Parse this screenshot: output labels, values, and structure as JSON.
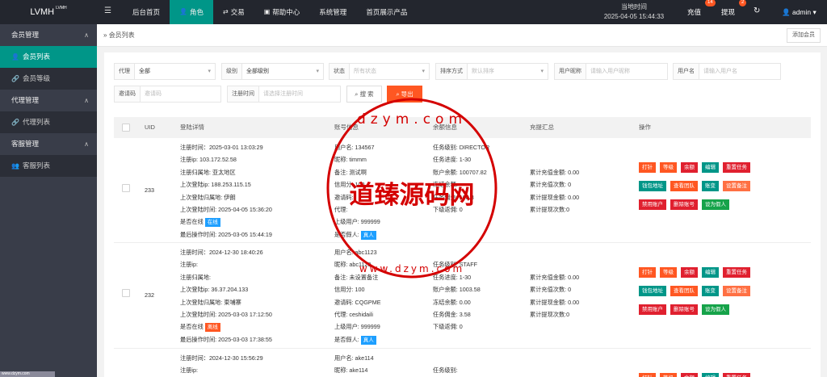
{
  "app": {
    "logo": "LVMH",
    "logo_sup": "LVMH"
  },
  "topnav": [
    {
      "label": "后台首页",
      "icon": "",
      "active": false
    },
    {
      "label": "角色",
      "icon": "user-icon",
      "active": true
    },
    {
      "label": "交易",
      "icon": "exchange-icon",
      "active": false
    },
    {
      "label": "帮助中心",
      "icon": "message-icon",
      "active": false
    },
    {
      "label": "系统管理",
      "icon": "",
      "active": false
    },
    {
      "label": "首页展示产品",
      "icon": "",
      "active": false
    }
  ],
  "header": {
    "time_label": "当地时间",
    "time_value": "2025-04-05 15:44:33",
    "recharge": "充值",
    "recharge_count": "14",
    "withdraw": "提现",
    "withdraw_count": "2",
    "user": "admin"
  },
  "sidebar": [
    {
      "label": "会员管理",
      "type": "group"
    },
    {
      "label": "会员列表",
      "type": "sub",
      "active": true,
      "icon": "user-icon"
    },
    {
      "label": "会员等级",
      "type": "sub",
      "active": false,
      "icon": "link-icon"
    },
    {
      "label": "代理管理",
      "type": "group"
    },
    {
      "label": "代理列表",
      "type": "sub",
      "active": false,
      "icon": "link-icon"
    },
    {
      "label": "客服管理",
      "type": "group"
    },
    {
      "label": "客服列表",
      "type": "sub",
      "active": false,
      "icon": "users-icon"
    }
  ],
  "breadcrumb": {
    "sep": "»",
    "current": "会员列表"
  },
  "add_member": "添加会员",
  "filters": {
    "agent": {
      "label": "代理",
      "value": "全部"
    },
    "level": {
      "label": "级别",
      "value": "全部级别"
    },
    "status": {
      "label": "状态",
      "value": "所有状态"
    },
    "sort": {
      "label": "排序方式",
      "value": "默认排序"
    },
    "nickname": {
      "label": "用户昵称",
      "placeholder": "请输入用户昵称"
    },
    "username": {
      "label": "用户名",
      "placeholder": "请输入用户名"
    },
    "invite": {
      "label": "邀请码",
      "placeholder": "邀请码"
    },
    "regtime": {
      "label": "注册时间",
      "placeholder": "请选择注册时间"
    },
    "search": "搜 索",
    "export": "导出"
  },
  "table": {
    "headers": {
      "uid": "UID",
      "login": "登陆详情",
      "account": "账号信息",
      "balance": "余额信息",
      "summary": "充提汇总",
      "ops": "操作"
    },
    "rows": [
      {
        "uid": "233",
        "login": [
          "注册时间：2025-03-01 13:03:29",
          "注册ip: 103.172.52.58",
          "注册归属地: 亚太地区",
          "上次登陆ip: 188.253.115.15",
          "上次登陆归属地: 伊朗",
          "上次登陆时间: 2025-04-05 15:36:20",
          "是否在线",
          "最后操作时间: 2025-03-05 15:44:19"
        ],
        "online": "在线",
        "account": [
          "用户名: 134567",
          "昵称: timmm",
          "备注: 测试啊",
          "信用分: 100",
          "邀请码:",
          "代理:",
          "上级用户: 999999",
          "是否假人:"
        ],
        "fake": "真人",
        "balance": [
          "",
          "任务级别: DIRECTOR",
          "任务进度: 1-30",
          "账户余额: 100707.82",
          "冻结余额:",
          "任务佣金: 108.8",
          "下级返佣: 0"
        ],
        "summary": [
          "",
          "",
          "累计充值金额: 0.00",
          "累计充值次数: 0",
          "累计提现金额: 0.00",
          "累计提现次数:0"
        ]
      },
      {
        "uid": "232",
        "login": [
          "注册时间：2024-12-30 18:40:26",
          "注册ip:",
          "注册归属地:",
          "上次登陆ip: 36.37.204.133",
          "上次登陆归属地: 柬埔寨",
          "上次登陆时间: 2025-03-03 17:12:50",
          "是否在线",
          "最后操作时间: 2025-03-03 17:38:55"
        ],
        "online": "离线",
        "account": [
          "用户名: abc1123",
          "昵称: abc1123",
          "备注: 未设置备注",
          "信用分: 100",
          "邀请码: CQGPME",
          "代理: ceshidaili",
          "上级用户: 999999",
          "是否假人:"
        ],
        "fake": "真人",
        "balance": [
          "",
          "任务级别: STAFF",
          "任务进度: 1-30",
          "账户余额: 1003.58",
          "冻结余额: 0.00",
          "任务佣金: 3.58",
          "下级返佣: 0"
        ],
        "summary": [
          "",
          "",
          "累计充值金额: 0.00",
          "累计充值次数: 0",
          "累计提现金额: 0.00",
          "累计提现次数:0"
        ]
      },
      {
        "uid": "",
        "login": [
          "注册时间：2024-12-30 15:56:29",
          "注册ip:"
        ],
        "account": [
          "用户名: ake114",
          "昵称: ake114"
        ],
        "balance": [
          "",
          "任务级别:"
        ]
      }
    ],
    "ops": [
      [
        {
          "label": "打针",
          "c": "o"
        },
        {
          "label": "等级",
          "c": "o"
        },
        {
          "label": "余额",
          "c": "r"
        },
        {
          "label": "编辑",
          "c": "g"
        },
        {
          "label": "重置任务",
          "c": "r"
        }
      ],
      [
        {
          "label": "钱包地址",
          "c": "g"
        },
        {
          "label": "查看团队",
          "c": "o"
        },
        {
          "label": "账变",
          "c": "g"
        },
        {
          "label": "设置备注",
          "c": "c"
        }
      ],
      [
        {
          "label": "禁用账户",
          "c": "r"
        },
        {
          "label": "删除账号",
          "c": "r"
        },
        {
          "label": "设为假人",
          "c": "gr"
        }
      ]
    ]
  },
  "watermark": {
    "text": "道臻源码网",
    "url_top": "dzym.com",
    "url_bottom": "www.dzym.com"
  },
  "bottom_tip": "www.dzym.com"
}
